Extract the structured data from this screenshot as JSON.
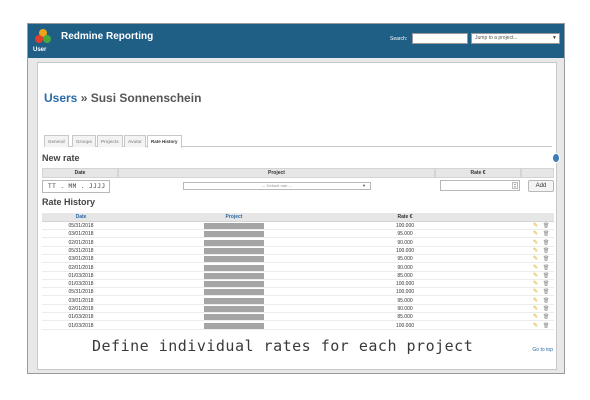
{
  "header": {
    "app_title": "Redmine Reporting",
    "user_label": "User",
    "search_label": "Search:",
    "search_value": "",
    "jump_placeholder": "Jump to a project..."
  },
  "page": {
    "breadcrumb_link": "Users",
    "breadcrumb_sep": " » ",
    "breadcrumb_current": "Susi Sonnenschein"
  },
  "tabs": [
    {
      "label": "General"
    },
    {
      "label": "Groups"
    },
    {
      "label": "Projects"
    },
    {
      "label": "Avatar"
    },
    {
      "label": "Rate History",
      "active": true
    }
  ],
  "new_rate": {
    "title": "New rate",
    "col_date": "Date",
    "col_project": "Project",
    "col_rate": "Rate €",
    "date_placeholder": "TT . MM . JJJJ",
    "project_default": "--- Default rate ---",
    "add_label": "Add"
  },
  "history": {
    "title": "Rate History",
    "col_date": "Date",
    "col_project": "Project",
    "col_rate": "Rate €",
    "rows": [
      {
        "date": "05/31/2018",
        "rate": "100.000"
      },
      {
        "date": "03/01/2018",
        "rate": "95.000"
      },
      {
        "date": "02/01/2018",
        "rate": "90.000"
      },
      {
        "date": "05/31/2018",
        "rate": "100.000"
      },
      {
        "date": "03/01/2018",
        "rate": "95.000"
      },
      {
        "date": "02/01/2018",
        "rate": "90.000"
      },
      {
        "date": "01/03/2018",
        "rate": "85.000"
      },
      {
        "date": "01/03/2018",
        "rate": "100.000"
      },
      {
        "date": "05/31/2018",
        "rate": "100.000"
      },
      {
        "date": "03/01/2018",
        "rate": "95.000"
      },
      {
        "date": "02/01/2018",
        "rate": "90.000"
      },
      {
        "date": "01/03/2018",
        "rate": "85.000"
      },
      {
        "date": "01/03/2018",
        "rate": "100.000"
      }
    ]
  },
  "go_top": "Go to top",
  "caption": "Define individual rates for each project",
  "colors": {
    "header_bg": "#1f5f86",
    "link": "#2a6aa8",
    "edit_icon": "#d6a21c"
  },
  "icons": [
    "logo-icon",
    "edit-icon",
    "delete-icon",
    "chevron-down-icon"
  ]
}
